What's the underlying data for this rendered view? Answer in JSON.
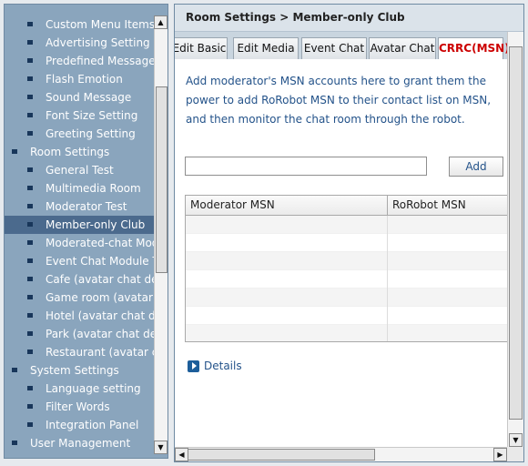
{
  "sidebar": {
    "items": [
      {
        "label": "Custom Menu Items",
        "level": 1
      },
      {
        "label": "Advertising Setting",
        "level": 1
      },
      {
        "label": "Predefined Message",
        "level": 1
      },
      {
        "label": "Flash Emotion",
        "level": 1
      },
      {
        "label": "Sound Message",
        "level": 1
      },
      {
        "label": "Font Size Setting",
        "level": 1
      },
      {
        "label": "Greeting Setting",
        "level": 1
      },
      {
        "label": "Room Settings",
        "level": 0
      },
      {
        "label": "General Test",
        "level": 1
      },
      {
        "label": "Multimedia Room",
        "level": 1
      },
      {
        "label": "Moderator Test",
        "level": 1
      },
      {
        "label": "Member-only Club",
        "level": 1,
        "selected": true
      },
      {
        "label": "Moderated-chat Module",
        "level": 1
      },
      {
        "label": "Event Chat Module Test",
        "level": 1
      },
      {
        "label": "Cafe (avatar chat demo)",
        "level": 1
      },
      {
        "label": "Game room (avatar chat)",
        "level": 1
      },
      {
        "label": "Hotel (avatar chat demo)",
        "level": 1
      },
      {
        "label": "Park (avatar chat demo)",
        "level": 1
      },
      {
        "label": "Restaurant (avatar chat)",
        "level": 1
      },
      {
        "label": "System Settings",
        "level": 0
      },
      {
        "label": "Language setting",
        "level": 1
      },
      {
        "label": "Filter Words",
        "level": 1
      },
      {
        "label": "Integration Panel",
        "level": 1
      },
      {
        "label": "User Management",
        "level": 0
      }
    ]
  },
  "header": {
    "title": "Room Settings > Member-only Club"
  },
  "tabs": [
    {
      "label": "Edit Basic"
    },
    {
      "label": "Edit Media"
    },
    {
      "label": "Event Chat"
    },
    {
      "label": "Avatar Chat"
    },
    {
      "label": "CRRC(MSN)",
      "active": true
    }
  ],
  "content": {
    "intro": "Add moderator's MSN accounts here to grant them the power to add RoRobot MSN to their contact list on MSN, and then monitor the chat room through the robot.",
    "input_value": "",
    "add_label": "Add",
    "table": {
      "columns": [
        "Moderator MSN",
        "RoRobot MSN"
      ],
      "rows": []
    },
    "details_label": "Details"
  },
  "colors": {
    "sidebar_bg": "#8aa5bd",
    "selected_bg": "#4b6a8d",
    "active_tab_text": "#cc0000",
    "body_text": "#24538a"
  }
}
